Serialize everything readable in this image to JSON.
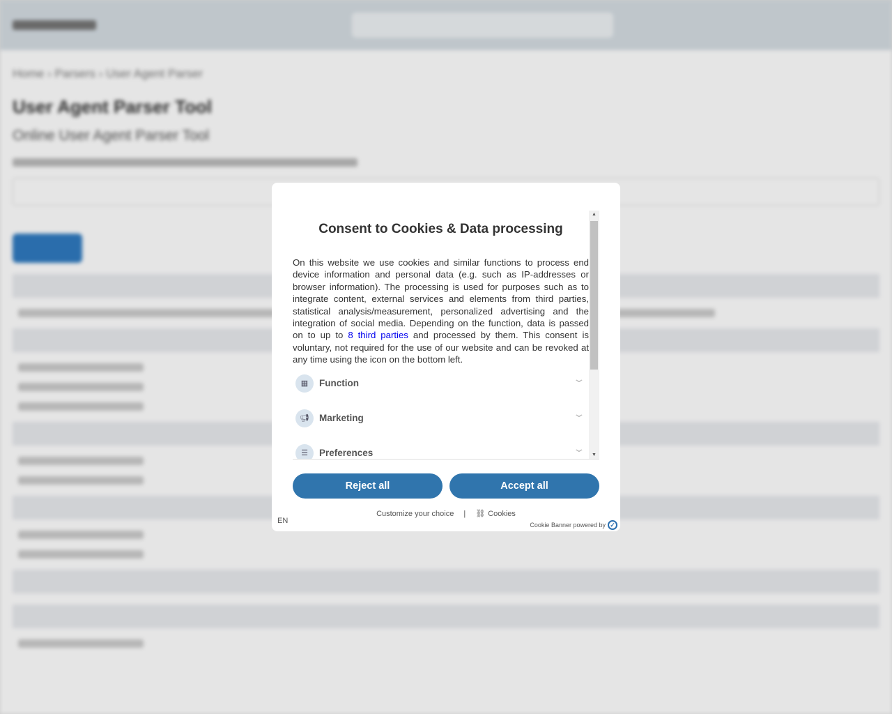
{
  "background": {
    "breadcrumb": "Home  ›  Parsers  ›  User Agent Parser",
    "title": "User Agent Parser Tool",
    "subtitle": "Online User Agent Parser Tool"
  },
  "modal": {
    "title": "Consent to Cookies & Data processing",
    "text_before_link": "On this website we use cookies and similar functions to process end device information and personal data (e.g. such as IP-addresses or browser information). The processing is used for purposes such as to integrate content, external services and elements from third parties, statistical analysis/measurement, personalized advertising and the integration of social media. Depending on the function, data is passed on to up to ",
    "link": "8 third parties",
    "text_after_link": " and processed by them. This consent is voluntary, not required for the use of our website and can be revoked at any time using the icon on the bottom left.",
    "categories": [
      {
        "label": "Function",
        "icon": "grid-icon"
      },
      {
        "label": "Marketing",
        "icon": "megaphone-icon"
      },
      {
        "label": "Preferences",
        "icon": "sliders-icon"
      }
    ],
    "reject": "Reject all",
    "accept": "Accept all",
    "customize": "Customize your choice",
    "separator": "|",
    "cookies": "Cookies",
    "lang": "EN",
    "powered": "Cookie Banner powered by",
    "button_color": "#3075ad"
  }
}
